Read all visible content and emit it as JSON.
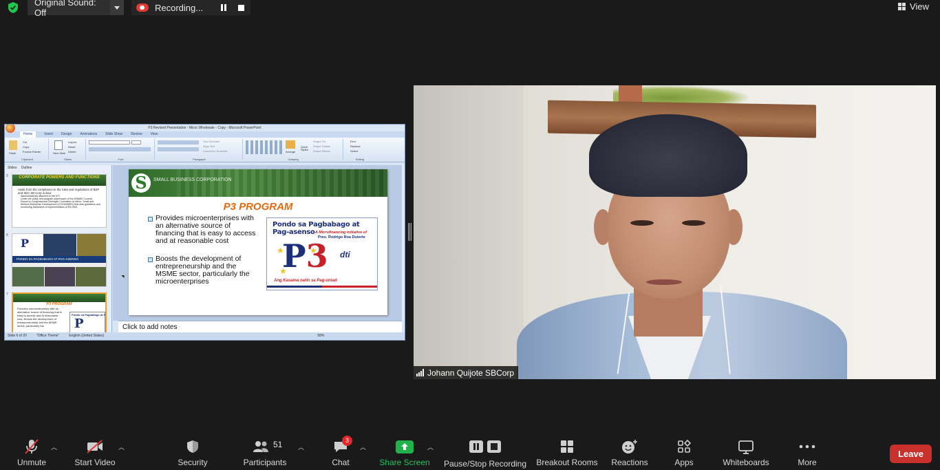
{
  "topbar": {
    "original_sound": "Original Sound: Off",
    "recording": "Recording...",
    "view": "View"
  },
  "shared_screen": {
    "window_title": "P3 Revised Presentation - Micro Wholesale - Copy - Microsoft PowerPoint",
    "ribbon_tabs": [
      "Home",
      "Insert",
      "Design",
      "Animations",
      "Slide Show",
      "Review",
      "View"
    ],
    "ribbon_groups": [
      "Clipboard",
      "Slides",
      "Font",
      "Paragraph",
      "Drawing",
      "Editing"
    ],
    "ribbon_items": {
      "cut": "Cut",
      "copy": "Copy",
      "format_painter": "Format Painter",
      "paste": "Paste",
      "new_slide": "New Slide",
      "layout": "Layout",
      "reset": "Reset",
      "delete": "Delete",
      "text_direction": "Text Direction",
      "align_text": "Align Text",
      "convert_smartart": "Convert to SmartArt",
      "arrange": "Arrange",
      "quick_styles": "Quick Styles",
      "shape_fill": "Shape Fill",
      "shape_outline": "Shape Outline",
      "shape_effects": "Shape Effects",
      "find": "Find",
      "replace": "Replace",
      "select": "Select"
    },
    "pane_tabs": [
      "Slides",
      "Outline"
    ],
    "thumbnails": {
      "t1_number": "5",
      "t1_title": "CORPORATE POWERS AND FUNCTIONS",
      "t1_text": "Aside from the compliance to the rules and regulations of BSP and SEC SB Corp is also:",
      "t1_b1": "Administratively attached to the DTI",
      "t1_b2": "Under the policy and program supervision of the MSMED Council",
      "t1_b3": "Report to Congressional Oversight Committee on Micro, Small and Medium Enterprise Development (COCMSMED) that sets guidelines and monitoring framework of implementation of RA 9501",
      "t2_number": "6",
      "t2_banner": "PONDO SA PAGBABAGO AT PAG-ASENSO",
      "t3_number": "7",
      "t3_title": "P3 PROGRAM",
      "t3_text": "Provides microenterprises with an alternative source of financing that is easy to access and at reasonable cost. Boosts the development of entrepreneurship and the MSME sector, particularly the"
    },
    "slide": {
      "brand_small": "SMALL BUSINESS CORPORATION",
      "title": "P3 PROGRAM",
      "bullet1": "Provides microenterprises with an alternative source of financing that is easy to access and at reasonable cost",
      "bullet2": "Boosts the development of entrepreneurship and the MSME sector, particularly the microenterprises",
      "logo_top": "Pondo sa Pagbabago at Pag-asenso",
      "logo_sub": "A Microfinancing initiative of",
      "logo_sub2": "Pres. Rodrigo Roa Duterte",
      "logo_big_p": "P",
      "logo_big_3": "3",
      "logo_dti": "dti",
      "logo_bottom": "Ang Kasama natin sa Pag-unlad"
    },
    "notes_placeholder": "Click to add notes",
    "status": {
      "slide_of": "Slide 6 of 20",
      "theme": "\"Office Theme\"",
      "language": "English (United States)",
      "zoom": "58%"
    }
  },
  "video": {
    "participant_name": "Johann Quijote SBCorp"
  },
  "toolbar": {
    "unmute": "Unmute",
    "start_video": "Start Video",
    "security": "Security",
    "participants": "Participants",
    "participants_count": "51",
    "chat": "Chat",
    "chat_badge": "3",
    "share_screen": "Share Screen",
    "pause_stop_recording": "Pause/Stop Recording",
    "breakout_rooms": "Breakout Rooms",
    "reactions": "Reactions",
    "apps": "Apps",
    "whiteboards": "Whiteboards",
    "more": "More",
    "leave": "Leave"
  }
}
